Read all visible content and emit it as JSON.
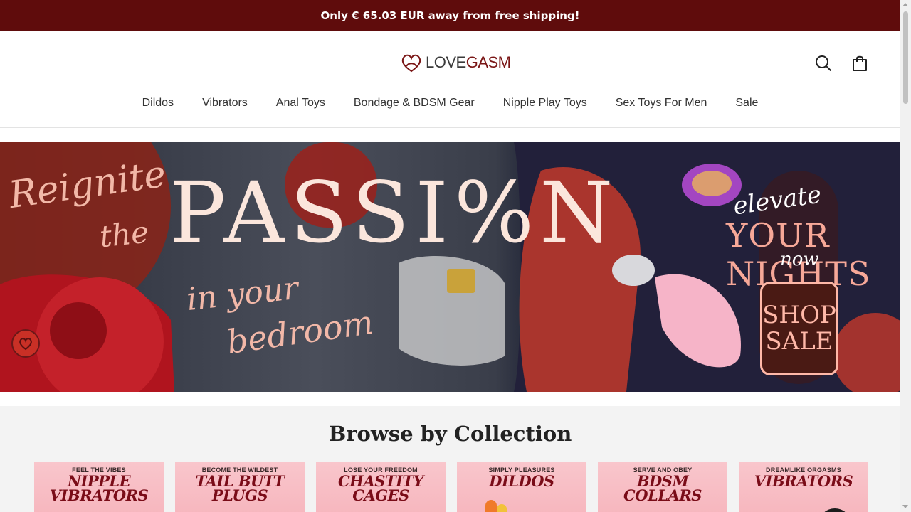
{
  "announcement": {
    "text": "Only € 65.03 EUR away from free shipping!"
  },
  "header": {
    "logo": {
      "text_main": "LOVE",
      "text_accent": "GASM"
    },
    "icons": [
      "search-icon",
      "cart-icon"
    ]
  },
  "nav": {
    "items": [
      {
        "label": "Dildos"
      },
      {
        "label": "Vibrators"
      },
      {
        "label": "Anal Toys"
      },
      {
        "label": "Bondage & BDSM Gear"
      },
      {
        "label": "Nipple Play Toys"
      },
      {
        "label": "Sex Toys For Men"
      },
      {
        "label": "Sale"
      }
    ]
  },
  "hero": {
    "line1": "Reignite",
    "line2": "the",
    "headline": "PASSI%N",
    "line3": "in your",
    "line4": "bedroom",
    "right_line1": "elevate",
    "right_line2": "YOUR NIGHTS",
    "right_line3": "now",
    "cta_line1": "SHOP",
    "cta_line2": "SALE"
  },
  "browse": {
    "title": "Browse by Collection",
    "collections": [
      {
        "kicker": "FEEL THE VIBES",
        "name_line1": "NIPPLE",
        "name_line2": "VIBRATORS"
      },
      {
        "kicker": "BECOME THE WILDEST",
        "name_line1": "TAIL BUTT",
        "name_line2": "PLUGS"
      },
      {
        "kicker": "LOSE YOUR FREEDOM",
        "name_line1": "CHASTITY",
        "name_line2": "CAGES"
      },
      {
        "kicker": "SIMPLY PLEASURES",
        "name_line1": "DILDOS",
        "name_line2": ""
      },
      {
        "kicker": "SERVE AND OBEY",
        "name_line1": "BDSM",
        "name_line2": "COLLARS"
      },
      {
        "kicker": "DREAMLIKE ORGASMS",
        "name_line1": "VIBRATORS",
        "name_line2": ""
      }
    ]
  },
  "colors": {
    "announcement_bg": "#5f0c0c",
    "brand_red": "#7a1616",
    "collection_text": "#7a0c18"
  }
}
